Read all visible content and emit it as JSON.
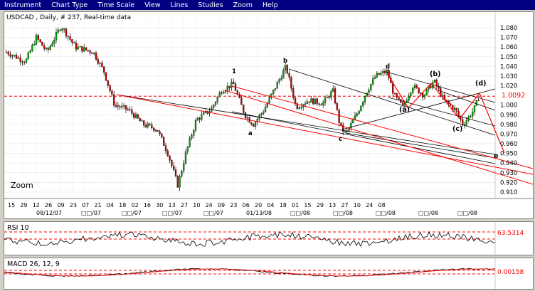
{
  "menu": [
    "Instrument",
    "Chart Type",
    "Time Scale",
    "View",
    "Lines",
    "Studies",
    "Zoom",
    "Help"
  ],
  "price_chart": {
    "title": "USDCAD , Daily, # 237, Real-time data",
    "zoom_label": "Zoom",
    "y_ticks": [
      "1.080",
      "1.070",
      "1.060",
      "1.050",
      "1.040",
      "1.030",
      "1.020",
      "1.010",
      "1.000",
      "0.990",
      "0.980",
      "0.970",
      "0.960",
      "0.950",
      "0.940",
      "0.930",
      "0.920",
      "0.910"
    ],
    "current_value": "1.0092",
    "x_day_ticks": [
      "15",
      "29",
      "12",
      "26",
      "09",
      "23",
      "07",
      "21",
      "04",
      "18",
      "02",
      "16",
      "30",
      "13",
      "27",
      "10",
      "24",
      "09",
      "23",
      "06",
      "20",
      "04",
      "18",
      "01",
      "15",
      "29",
      "13",
      "27",
      "10",
      "24",
      "08"
    ],
    "x_month_ticks": [
      "08/12/07",
      "□□/07",
      "□□/07",
      "□□/07",
      "□□/07",
      "01/13/08",
      "□□/08",
      "□□/08",
      "□□/08",
      "□□/08",
      "□□/08"
    ],
    "wave_labels": [
      "1",
      "a",
      "b",
      "c",
      "d",
      "(a)",
      "(b)",
      "(c)",
      "(d)",
      "e"
    ]
  },
  "rsi": {
    "label": "RSI 10",
    "value": "63.5314"
  },
  "macd": {
    "label": "MACD 26, 12, 9",
    "value": "0.00158"
  },
  "colors": {
    "menubar": "#000080",
    "up_candle": "#00aa00",
    "down_candle": "#cc0000",
    "trendline": "#ff0000",
    "grid": "#c8c8c8"
  }
}
